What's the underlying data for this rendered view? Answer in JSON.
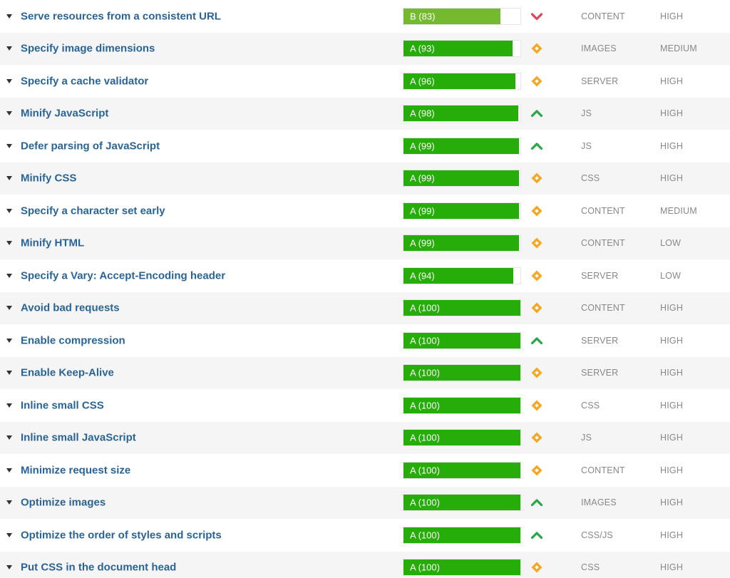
{
  "rules": [
    {
      "name": "Serve resources from a consistent URL",
      "grade": "B (83)",
      "score": 83,
      "trend": "down",
      "type": "CONTENT",
      "priority": "HIGH"
    },
    {
      "name": "Specify image dimensions",
      "grade": "A (93)",
      "score": 93,
      "trend": "neutral",
      "type": "IMAGES",
      "priority": "MEDIUM"
    },
    {
      "name": "Specify a cache validator",
      "grade": "A (96)",
      "score": 96,
      "trend": "neutral",
      "type": "SERVER",
      "priority": "HIGH"
    },
    {
      "name": "Minify JavaScript",
      "grade": "A (98)",
      "score": 98,
      "trend": "up",
      "type": "JS",
      "priority": "HIGH"
    },
    {
      "name": "Defer parsing of JavaScript",
      "grade": "A (99)",
      "score": 99,
      "trend": "up",
      "type": "JS",
      "priority": "HIGH"
    },
    {
      "name": "Minify CSS",
      "grade": "A (99)",
      "score": 99,
      "trend": "neutral",
      "type": "CSS",
      "priority": "HIGH"
    },
    {
      "name": "Specify a character set early",
      "grade": "A (99)",
      "score": 99,
      "trend": "neutral",
      "type": "CONTENT",
      "priority": "MEDIUM"
    },
    {
      "name": "Minify HTML",
      "grade": "A (99)",
      "score": 99,
      "trend": "neutral",
      "type": "CONTENT",
      "priority": "LOW"
    },
    {
      "name": "Specify a Vary: Accept-Encoding header",
      "grade": "A (94)",
      "score": 94,
      "trend": "neutral",
      "type": "SERVER",
      "priority": "LOW"
    },
    {
      "name": "Avoid bad requests",
      "grade": "A (100)",
      "score": 100,
      "trend": "neutral",
      "type": "CONTENT",
      "priority": "HIGH"
    },
    {
      "name": "Enable compression",
      "grade": "A (100)",
      "score": 100,
      "trend": "up",
      "type": "SERVER",
      "priority": "HIGH"
    },
    {
      "name": "Enable Keep-Alive",
      "grade": "A (100)",
      "score": 100,
      "trend": "neutral",
      "type": "SERVER",
      "priority": "HIGH"
    },
    {
      "name": "Inline small CSS",
      "grade": "A (100)",
      "score": 100,
      "trend": "neutral",
      "type": "CSS",
      "priority": "HIGH"
    },
    {
      "name": "Inline small JavaScript",
      "grade": "A (100)",
      "score": 100,
      "trend": "neutral",
      "type": "JS",
      "priority": "HIGH"
    },
    {
      "name": "Minimize request size",
      "grade": "A (100)",
      "score": 100,
      "trend": "neutral",
      "type": "CONTENT",
      "priority": "HIGH"
    },
    {
      "name": "Optimize images",
      "grade": "A (100)",
      "score": 100,
      "trend": "up",
      "type": "IMAGES",
      "priority": "HIGH"
    },
    {
      "name": "Optimize the order of styles and scripts",
      "grade": "A (100)",
      "score": 100,
      "trend": "up",
      "type": "CSS/JS",
      "priority": "HIGH"
    },
    {
      "name": "Put CSS in the document head",
      "grade": "A (100)",
      "score": 100,
      "trend": "neutral",
      "type": "CSS",
      "priority": "HIGH"
    }
  ],
  "icons": {
    "toggle": "caret-down-icon",
    "up": "chevron-up-icon",
    "down": "chevron-down-icon",
    "neutral": "diamond-icon"
  },
  "colors": {
    "grade_a": "#26ad0a",
    "grade_b": "#75ba2e",
    "trend_up": "#28a745",
    "trend_down": "#e0435a",
    "trend_neutral": "#f5a623",
    "rule_link": "#2a6496"
  }
}
